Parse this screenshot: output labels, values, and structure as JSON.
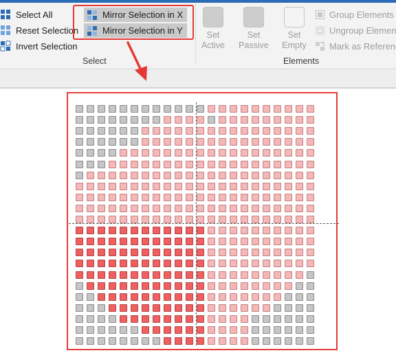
{
  "select_group": {
    "label": "Select",
    "select_all": "Select All",
    "reset_selection": "Reset Selection",
    "invert_selection": "Invert Selection",
    "mirror_x": "Mirror Selection in X",
    "mirror_y": "Mirror Selection in Y"
  },
  "elements_group": {
    "label": "Elements",
    "set_active": [
      "Set",
      "Active"
    ],
    "set_passive": [
      "Set",
      "Passive"
    ],
    "set_empty": [
      "Set",
      "Empty"
    ],
    "group_elements": "Group Elements",
    "ungroup_elements": "Ungroup Elemen",
    "mark_as_reference": "Mark as Referenc"
  },
  "colors": {
    "accent": "#2b6cb7",
    "highlight_red": "#e53935",
    "element_passive": "#c6c6c6",
    "element_unselected": "#f4b8b8",
    "element_selected": "#f06060"
  },
  "grid": {
    "cols": 22,
    "rows": 22,
    "legend": "g = passive (grey), p = unselected (pink), r = selected (red)",
    "rows_data": [
      "ggggggggggggpppppppppp",
      "ggggggggppppgppppppppp",
      "ggggggpppppppppppppppp",
      "ggggggpppppppppppppppp",
      "ggggpppppppppppppppppp",
      "gggppppppppppppppppppp",
      "gppppppppppppppppppppp",
      "pppppppppppppppppppppp",
      "pppppppppppppppppppppp",
      "pppppppppppppppppppppp",
      "pppppppppppppppppppppp",
      "rrrrrrrrrrrrpppppppppp",
      "rrrrrrrrrrrrpppppppppp",
      "rrrrrrrrrrrrpppppppppp",
      "rrrrrrrrrrrrpppppppppp",
      "rrrrrrrrrrrrpppppppppg",
      "grrrrrrrrrrrppppppppgg",
      "ggrrrrrrrrrrpppppppggg",
      "gggrrrrrrrrrppppppgggg",
      "ggggrrrrrrrrppppgggggg",
      "ggggggrrrrrrppppgggggg",
      "ggggggggrrrrppppgggggg"
    ]
  }
}
